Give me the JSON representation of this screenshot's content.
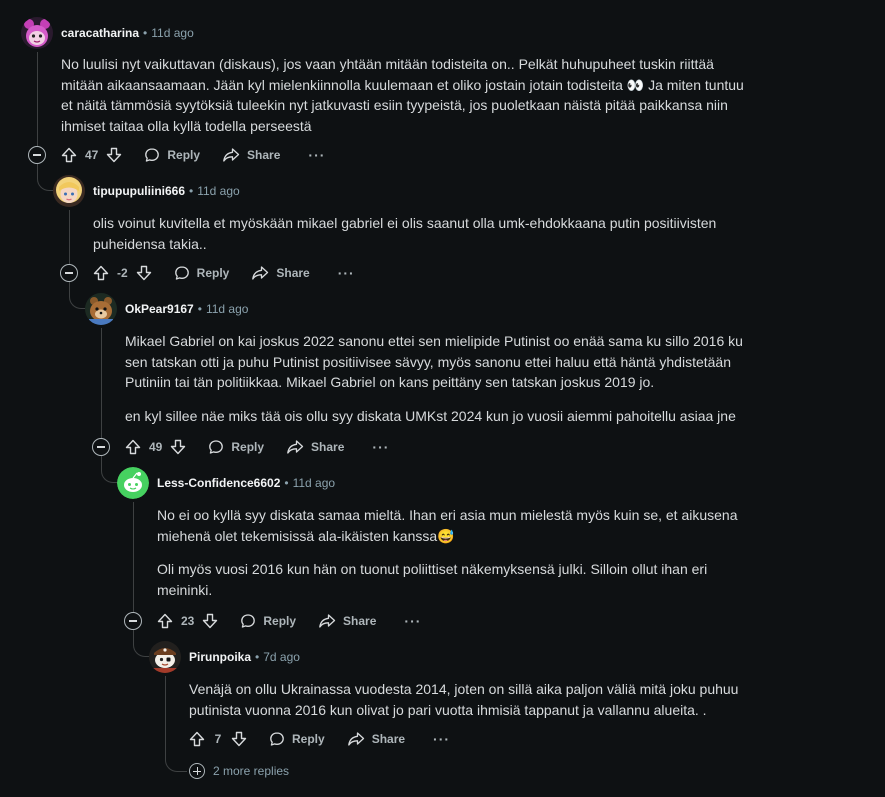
{
  "comments": [
    {
      "author": "caracatharina",
      "time": "11d ago",
      "paragraphs": [
        "No luulisi nyt vaikuttavan (diskaus), jos vaan yhtään mitään todisteita on.. Pelkät huhupuheet tuskin riittää mitään aikaansaamaan. Jään kyl mielenkiinnolla kuulemaan et oliko jostain jotain todisteita 👀 Ja miten tuntuu et näitä tämmösiä syytöksiä tuleekin nyt jatkuvasti esiin tyypeistä, jos puoletkaan näistä pitää paikkansa niin ihmiset taitaa olla kyllä todella perseestä"
      ],
      "score": "47",
      "avatar": "pink-character-avatar"
    },
    {
      "author": "tipupupuliini666",
      "time": "11d ago",
      "paragraphs": [
        "olis voinut kuvitella et myöskään mikael gabriel ei olis saanut olla umk-ehdokkaana putin positiivisten puheidensa takia.."
      ],
      "score": "-2",
      "avatar": "blonde-character-avatar"
    },
    {
      "author": "OkPear9167",
      "time": "11d ago",
      "paragraphs": [
        "Mikael Gabriel on kai joskus 2022 sanonu ettei sen mielipide Putinist oo enää sama ku sillo 2016 ku sen tatskan otti ja puhu Putinist positiivisee sävyy, myös sanonu ettei haluu että häntä yhdistetään Putiniin tai tän politiikkaa. Mikael Gabriel on kans peittäny sen tatskan joskus 2019 jo.",
        "en kyl sillee näe miks tää ois ollu syy diskata UMKst 2024 kun jo vuosii aiemmi pahoitellu asiaa jne"
      ],
      "score": "49",
      "avatar": "bear-character-avatar"
    },
    {
      "author": "Less-Confidence6602",
      "time": "11d ago",
      "paragraphs": [
        "No ei oo kyllä syy diskata samaa mieltä. Ihan eri asia mun mielestä myös kuin se, et aikusena miehenä olet tekemisissä ala-ikäisten kanssa😅",
        "Oli myös vuosi 2016 kun hän on tuonut poliittiset näkemyksensä julki. Silloin ollut ihan eri meininki."
      ],
      "score": "23",
      "avatar": "green-snoo-avatar"
    },
    {
      "author": "Pirunpoika",
      "time": "7d ago",
      "paragraphs": [
        "Venäjä on ollu Ukrainassa vuodesta 2014, joten on sillä aika paljon väliä mitä joku puhuu putinista vuonna 2016 kun olivat jo pari vuotta ihmisiä tappanut ja vallannu alueita. ."
      ],
      "score": "7",
      "avatar": "pirate-snoo-avatar"
    }
  ],
  "actions": {
    "reply": "Reply",
    "share": "Share",
    "more": "···"
  },
  "more_replies": "2 more replies",
  "icons": {
    "upvote": "upvote-icon",
    "downvote": "downvote-icon",
    "reply": "reply-icon",
    "share": "share-icon",
    "collapse": "collapse-icon",
    "expand": "expand-icon"
  }
}
